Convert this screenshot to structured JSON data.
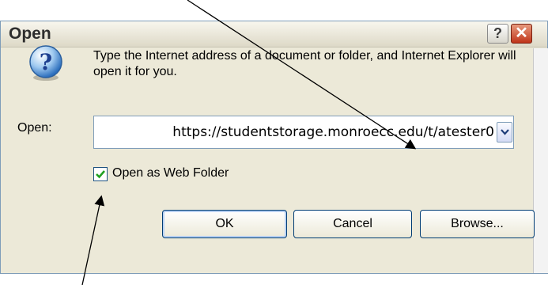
{
  "window": {
    "title": "Open",
    "help_glyph": "?",
    "close_glyph": "✕"
  },
  "message": {
    "text": "Type the Internet address of a document or folder, and Internet Explorer will open it for you.",
    "icon": "info-question-icon"
  },
  "address": {
    "label": "Open:",
    "value": "https://studentstorage.monroecc.edu/t/atester0"
  },
  "web_folder": {
    "label": "Open as Web Folder",
    "checked": true
  },
  "buttons": {
    "ok": "OK",
    "cancel": "Cancel",
    "browse": "Browse..."
  },
  "colors": {
    "dialog_bg": "#ece9d8",
    "close_red": "#c0351a",
    "check_green": "#21a121",
    "button_border": "#003c74"
  }
}
